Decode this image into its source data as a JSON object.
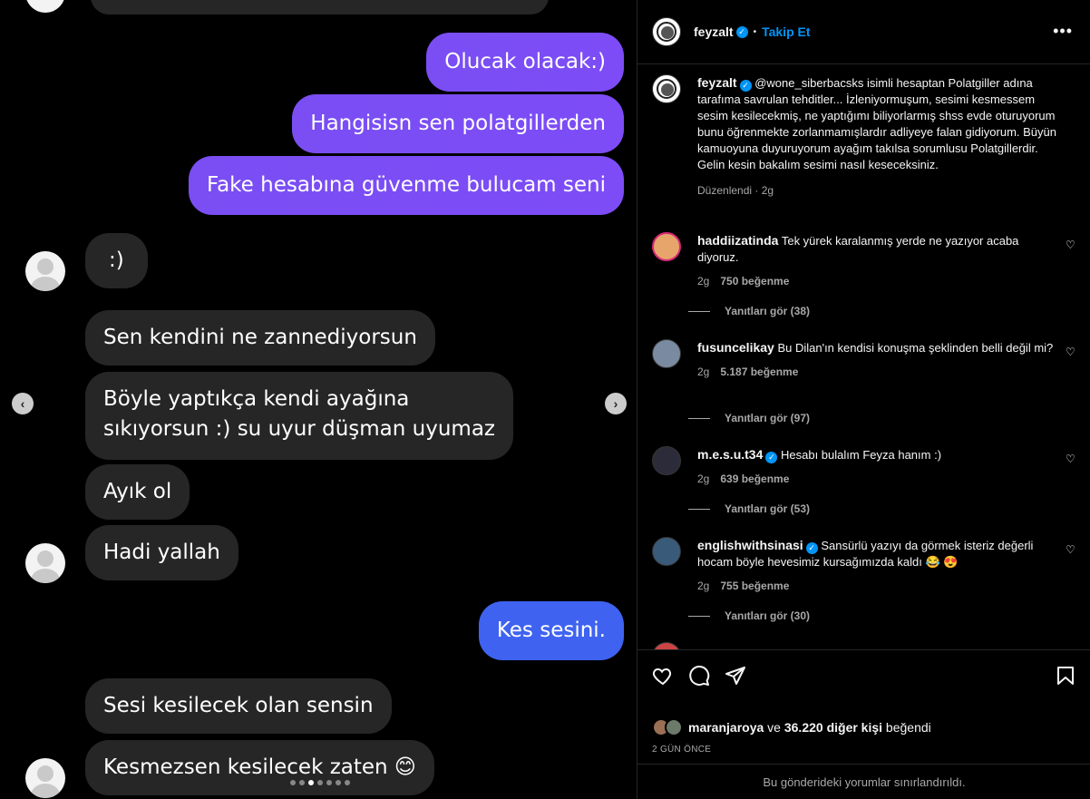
{
  "chat": {
    "outgoing": [
      "Olucak olacak:)",
      "Hangisisn sen polatgillerden",
      "Fake hesabına güvenme bulucam seni",
      "Kes sesini."
    ],
    "incoming": [
      ":)",
      "Sen kendini ne zannediyorsun",
      "Böyle yaptıkça kendi ayağına",
      "sıkıyorsun :) su uyur düşman uyumaz",
      "Ayık ol",
      "Hadi yallah",
      "Sesi kesilecek olan sensin",
      "Kesmezsen kesilecek zaten 😊"
    ],
    "carousel_dots": 7,
    "active_dot": 2
  },
  "header": {
    "username": "feyzalt",
    "separator": "•",
    "follow_label": "Takip Et",
    "more_label": "•••"
  },
  "caption": {
    "username": "feyzalt",
    "text": "@wone_siberbacsks isimli hesaptan Polatgiller adına tarafıma savrulan tehditler... İzleniyormuşum, sesimi kesmessem sesim kesilecekmiş, ne yaptığımı biliyorlarmış shss evde oturuyorum bunu öğrenmekte zorlanmamışlardır adliyeye falan gidiyorum. Büyün kamuoyuna duyuruyorum ayağım takılsa sorumlusu Polatgillerdir. Gelin kesin bakalım sesimi nasıl keseceksiniz.",
    "meta": "Düzenlendi · 2g"
  },
  "comments": [
    {
      "username": "haddiizatinda",
      "verified": false,
      "text": "Tek yürek karalanmış yerde ne yazıyor acaba diyoruz.",
      "time": "2g",
      "likes": "750 beğenme",
      "replies": "Yanıtları gör (38)"
    },
    {
      "username": "fusuncelikay",
      "verified": false,
      "text": "Bu Dilan'ın kendisi konuşma şeklinden belli değil mi?",
      "time": "2g",
      "likes": "5.187 beğenme",
      "replies": "Yanıtları gör (97)"
    },
    {
      "username": "m.e.s.u.t34",
      "verified": true,
      "text": "Hesabı bulalım Feyza hanım :)",
      "time": "2g",
      "likes": "639 beğenme",
      "replies": "Yanıtları gör (53)"
    },
    {
      "username": "englishwithsinasi",
      "verified": true,
      "text": "Sansürlü yazıyı da görmek isteriz değerli hocam böyle hevesimiz kursağımızda kaldı 😂 😍",
      "time": "2g",
      "likes": "755 beğenme",
      "replies": "Yanıtları gör (30)"
    }
  ],
  "footer": {
    "liked_by_user": "maranjaroya",
    "liked_by_middle": " ve ",
    "liked_by_others": "36.220 diğer kişi",
    "liked_by_suffix": " beğendi",
    "time_ago": "2 GÜN ÖNCE",
    "comments_limited": "Bu gönderideki yorumlar sınırlandırıldı."
  },
  "colors": {
    "outgoing_bubble": "#7a4ef3",
    "outgoing_bubble_last": "#3f63f0",
    "incoming_bubble": "#262626",
    "link_blue": "#0095f6",
    "panel_bg": "#000000"
  }
}
